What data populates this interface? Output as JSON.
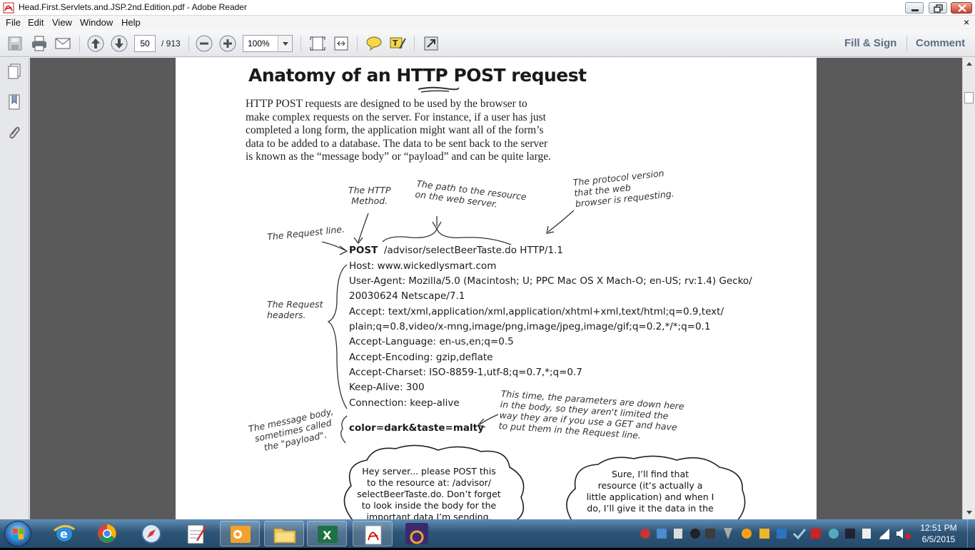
{
  "window": {
    "title": "Head.First.Servlets.and.JSP.2nd.Edition.pdf - Adobe Reader"
  },
  "menu": {
    "items": [
      "File",
      "Edit",
      "View",
      "Window",
      "Help"
    ],
    "close_glyph": "×"
  },
  "toolbar": {
    "current_page": "50",
    "page_total": "/ 913",
    "zoom": "100%",
    "fill_sign": "Fill & Sign",
    "comment": "Comment"
  },
  "page": {
    "heading": "Anatomy of an HTTP POST request",
    "intro_lines": [
      "HTTP POST requests are designed to be used by the browser to",
      "make complex requests on the server.  For instance, if a user has just",
      "completed a long form, the application might want all of the form’s",
      "data to be added to a database.  The data to be sent back to the server",
      "is known as the “message body” or “payload” and can be quite large."
    ],
    "annotations": {
      "http_method": "The HTTP\nMethod.",
      "path": "The path to the resource\non the web server.",
      "protocol": "The protocol version\nthat the web\nbrowser is requesting.",
      "request_line": "The Request line.",
      "request_headers": "The Request\nheaders.",
      "message_body": "The message body,\nsometimes called\nthe \"payload\".",
      "body_params": "This time, the parameters are down here\nin the body, so they aren't limited the\nway they are if you use a GET and have\nto put them in the Request line."
    },
    "request": {
      "method": "POST",
      "line_rest": "/advisor/selectBeerTaste.do HTTP/1.1",
      "headers": [
        "Host: www.wickedlysmart.com",
        "User-Agent: Mozilla/5.0 (Macintosh; U; PPC Mac OS X Mach-O; en-US; rv:1.4) Gecko/",
        "20030624 Netscape/7.1",
        "Accept: text/xml,application/xml,application/xhtml+xml,text/html;q=0.9,text/",
        "plain;q=0.8,video/x-mng,image/png,image/jpeg,image/gif;q=0.2,*/*;q=0.1",
        "Accept-Language: en-us,en;q=0.5",
        "Accept-Encoding: gzip,deflate",
        "Accept-Charset: ISO-8859-1,utf-8;q=0.7,*;q=0.7",
        "Keep-Alive: 300",
        "Connection: keep-alive"
      ],
      "body": "color=dark&taste=malty"
    },
    "bubbles": {
      "client": "Hey server... please POST this\nto the resource at: /advisor/\nselectBeerTaste.do. Don’t forget\nto look inside the body for the\nimportant data I’m sending.",
      "server": "Sure, I’ll find that\nresource (it’s actually a\nlittle application) and when I\ndo, I’ll give it the data in the"
    }
  },
  "taskbar": {
    "apps": [
      "internet-explorer",
      "chrome",
      "safari",
      "notepad",
      "outlook",
      "file-explorer",
      "excel",
      "adobe-reader",
      "java-ee-ide"
    ],
    "java_label": "Java EE\nIDE",
    "time": "12:51 PM",
    "date": "6/5/2015"
  },
  "colors": {
    "accent_text": "#5a6e87",
    "doc_background": "#5a5a5a",
    "taskbar": "#2e5577"
  }
}
